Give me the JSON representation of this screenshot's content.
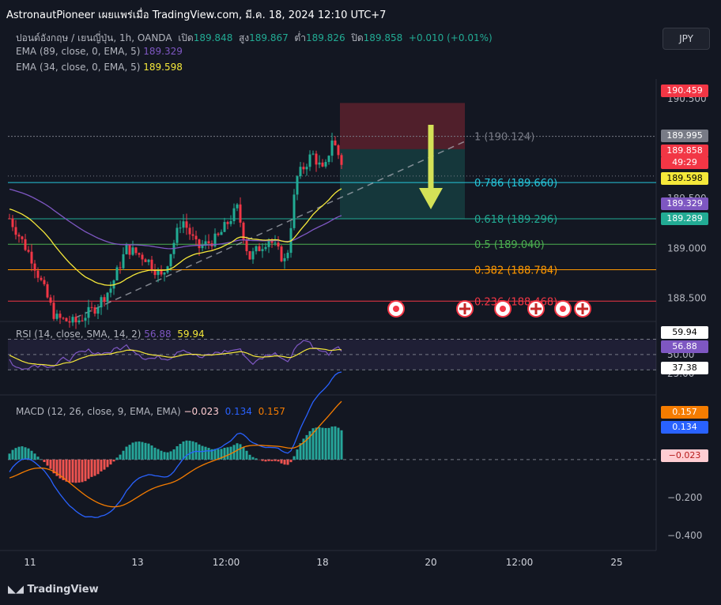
{
  "header": {
    "title": "AstronautPioneer เผยแพร่เมื่อ TradingView.com, มี.ค. 18, 2024 12:10 UTC+7"
  },
  "legend": {
    "symbol": "ปอนด์อังกฤษ / เยนญี่ปุ่น, 1h, OANDA",
    "open_label": "เปิด",
    "open": "189.848",
    "high_label": "สูง",
    "high": "189.867",
    "low_label": "ต่ำ",
    "low": "189.826",
    "close_label": "ปิด",
    "close": "189.858",
    "change": "+0.010 (+0.01%)",
    "ema89_label": "EMA (89, close, 0, EMA, 5)",
    "ema89_value": "189.329",
    "ema34_label": "EMA (34, close, 0, EMA, 5)",
    "ema34_value": "189.598"
  },
  "currency_button": "JPY",
  "colors": {
    "up": "#22ab94",
    "down": "#f23645",
    "ema34": "#f5e83a",
    "ema89": "#7e57c2",
    "background": "#131722"
  },
  "price_axis": {
    "ticks": [
      "190.500",
      "190.000",
      "189.500",
      "189.000",
      "188.500"
    ],
    "badges": [
      {
        "text": "190.459",
        "bg": "#f23645",
        "fg": "#ffffff",
        "price": 190.459
      },
      {
        "text": "189.995",
        "bg": "#787b86",
        "fg": "#ffffff",
        "price": 189.995
      },
      {
        "text": "189.858",
        "bg": "#f23645",
        "fg": "#ffffff",
        "price": 189.858
      },
      {
        "text": "49:29",
        "bg": "#f23645",
        "fg": "#ffffff",
        "price": 189.76
      },
      {
        "text": "189.598",
        "bg": "#f5e83a",
        "fg": "#000000",
        "price": 189.598
      },
      {
        "text": "189.329",
        "bg": "#7e57c2",
        "fg": "#ffffff",
        "price": 189.329
      },
      {
        "text": "189.289",
        "bg": "#22ab94",
        "fg": "#ffffff",
        "price": 189.289
      }
    ]
  },
  "fibonacci": [
    {
      "label": "1 (190.124)",
      "price": 190.124,
      "color": "#787b86"
    },
    {
      "label": "0.786 (189.660)",
      "price": 189.66,
      "color": "#26c6da"
    },
    {
      "label": "0.618 (189.296)",
      "price": 189.296,
      "color": "#22ab94"
    },
    {
      "label": "0.5 (189.040)",
      "price": 189.04,
      "color": "#4caf50"
    },
    {
      "label": "0.382 (188.784)",
      "price": 188.784,
      "color": "#ff9800"
    },
    {
      "label": "0.236 (188.468)",
      "price": 188.468,
      "color": "#f23645"
    }
  ],
  "position_tool": {
    "stop": 190.459,
    "entry": 189.995,
    "target": 189.296
  },
  "rsi": {
    "legend": "RSI (14, close, SMA, 14, 2)",
    "value_sma": "56.88",
    "value": "59.94",
    "axis": [
      "50.00",
      "25.00"
    ],
    "badges": [
      {
        "text": "59.94",
        "bg": "#ffffff",
        "fg": "#000000",
        "v": 59.94
      },
      {
        "text": "56.88",
        "bg": "#7e57c2",
        "fg": "#ffffff",
        "v": 56.88
      },
      {
        "text": "37.38",
        "bg": "#ffffff",
        "fg": "#000000",
        "v": 37.38
      }
    ]
  },
  "macd": {
    "legend": "MACD (12, 26, close, 9, EMA, EMA)",
    "hist": "−0.023",
    "macd": "0.134",
    "signal": "0.157",
    "axis": [
      "−0.200",
      "−0.400"
    ],
    "badges": [
      {
        "text": "0.157",
        "bg": "#f57c00",
        "fg": "#ffffff",
        "v": 0.157
      },
      {
        "text": "0.134",
        "bg": "#2962ff",
        "fg": "#ffffff",
        "v": 0.134
      },
      {
        "text": "−0.023",
        "bg": "#ffcdd2",
        "fg": "#b71c1c",
        "v": -0.023
      }
    ]
  },
  "time_axis": [
    "11",
    "13",
    "12:00",
    "18",
    "20",
    "12:00",
    "25"
  ],
  "brand": "TradingView",
  "chart_data": {
    "type": "candlestick",
    "symbol": "GBPJPY",
    "interval": "1h",
    "y_range": [
      188.28,
      190.7
    ],
    "x_labels": [
      "11",
      "13",
      "12:00",
      "18",
      "20",
      "12:00",
      "25"
    ],
    "ema34_end": 189.598,
    "ema89_end": 189.329,
    "last_close": 189.858
  }
}
